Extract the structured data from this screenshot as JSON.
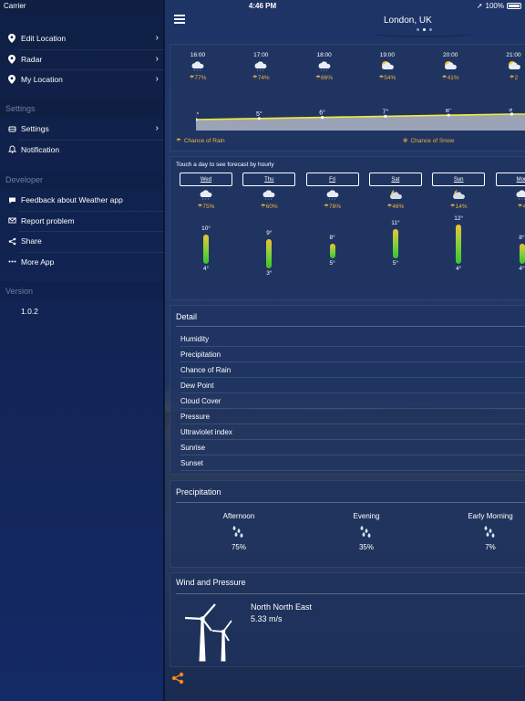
{
  "status": {
    "carrier": "Carrier",
    "time": "4:46 PM",
    "battery": "100%"
  },
  "sidebar": {
    "main_items": [
      {
        "label": "Edit Location",
        "icon": "location-pin-icon"
      },
      {
        "label": "Radar",
        "icon": "location-pin-icon"
      },
      {
        "label": "My Location",
        "icon": "location-pin-icon"
      }
    ],
    "settings_header": "Settings",
    "settings_items": [
      {
        "label": "Settings",
        "icon": "settings-icon"
      },
      {
        "label": "Notification",
        "icon": "bell-icon"
      }
    ],
    "developer_header": "Developer",
    "developer_items": [
      {
        "label": "Feedback about Weather app",
        "icon": "chat-icon"
      },
      {
        "label": "Report problem",
        "icon": "mail-icon"
      },
      {
        "label": "Share",
        "icon": "share-icon"
      },
      {
        "label": "More App",
        "icon": "more-icon"
      }
    ],
    "version_header": "Version",
    "version": "1.0.2"
  },
  "header": {
    "city": "London, UK"
  },
  "hourly": {
    "hours": [
      {
        "time": "16:00",
        "precip": "77%",
        "temp": "4°",
        "icon": "cloud-icon"
      },
      {
        "time": "17:00",
        "precip": "74%",
        "temp": "5°",
        "icon": "cloud-icon"
      },
      {
        "time": "18:00",
        "precip": "66%",
        "temp": "6°",
        "icon": "cloud-icon"
      },
      {
        "time": "19:00",
        "precip": "54%",
        "temp": "7°",
        "icon": "partly-cloudy-icon"
      },
      {
        "time": "20:00",
        "precip": "41%",
        "temp": "8°",
        "icon": "partly-cloudy-icon"
      },
      {
        "time": "21:00",
        "precip": "2",
        "temp": "9°",
        "icon": "partly-cloudy-icon"
      }
    ],
    "chance_rain": "Chance of Rain",
    "chance_snow": "Chance of Snow"
  },
  "daily": {
    "hint": "Touch a day to see forecast by hourly",
    "days": [
      {
        "day": "Wed",
        "precip": "75%",
        "hi": "10°",
        "lo": "4°",
        "high": 10,
        "low": 4,
        "icon": "cloud-icon"
      },
      {
        "day": "Thu",
        "precip": "60%",
        "hi": "9°",
        "lo": "3°",
        "high": 9,
        "low": 3,
        "icon": "cloud-icon"
      },
      {
        "day": "Fri",
        "precip": "76%",
        "hi": "8°",
        "lo": "5°",
        "high": 8,
        "low": 5,
        "icon": "cloud-icon"
      },
      {
        "day": "Sat",
        "precip": "46%",
        "hi": "11°",
        "lo": "5°",
        "high": 11,
        "low": 5,
        "icon": "night-cloud-icon"
      },
      {
        "day": "Sun",
        "precip": "14%",
        "hi": "12°",
        "lo": "4°",
        "high": 12,
        "low": 4,
        "icon": "night-cloud-icon"
      },
      {
        "day": "Mon",
        "precip": "4",
        "hi": "8°",
        "lo": "4°",
        "high": 8,
        "low": 4,
        "icon": "cloud-icon"
      }
    ]
  },
  "detail": {
    "title": "Detail",
    "rows": [
      "Humidity",
      "Precipitation",
      "Chance of Rain",
      "Dew Point",
      "Cloud Cover",
      "Pressure",
      "Ultraviolet index",
      "Sunrise",
      "Sunset"
    ]
  },
  "precipitation": {
    "title": "Precipitation",
    "periods": [
      {
        "label": "Afternoon",
        "value": "75%",
        "icon": "rain-drops-icon"
      },
      {
        "label": "Evening",
        "value": "35%",
        "icon": "rain-drops-icon"
      },
      {
        "label": "Early Morning",
        "value": "7%",
        "icon": "rain-drops-icon"
      }
    ]
  },
  "wind": {
    "title": "Wind and Pressure",
    "direction": "North North East",
    "speed": "5.33 m/s"
  },
  "colors": {
    "accent": "#f3b23a",
    "bar_top": "#f1c232",
    "bar_bottom": "#39c22d",
    "line": "#f5e93a"
  }
}
